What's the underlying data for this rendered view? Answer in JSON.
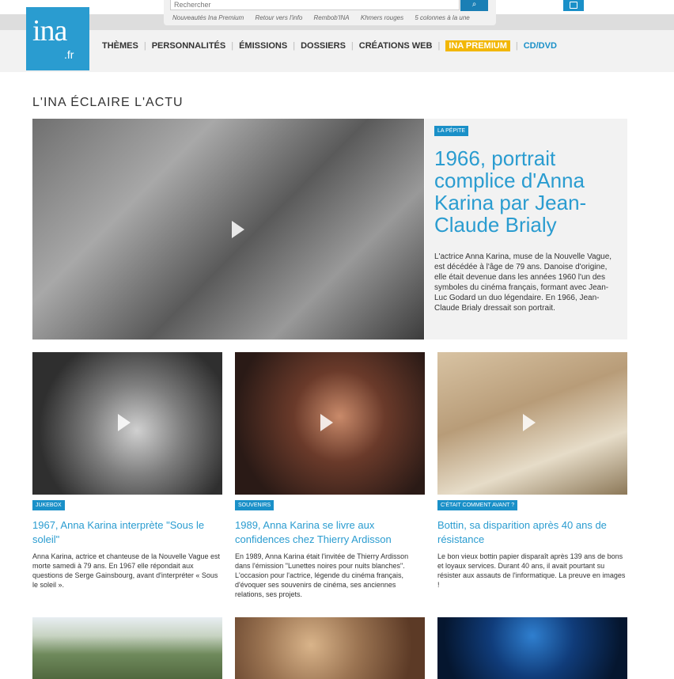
{
  "header": {
    "search_placeholder": "Rechercher",
    "search_button_icon": "search-icon",
    "quicklinks": [
      "Nouveautés Ina Premium",
      "Retour vers l'info",
      "Rembob'INA",
      "Khmers rouges",
      "5 colonnes à la une"
    ],
    "cart_icon": "cart-icon"
  },
  "logo": {
    "main": "ina",
    "suffix": ".fr"
  },
  "nav": {
    "items": [
      "THÈMES",
      "PERSONNALITÉS",
      "ÉMISSIONS",
      "DOSSIERS",
      "CRÉATIONS WEB"
    ],
    "premium": "INA PREMIUM",
    "cd": "CD/DVD"
  },
  "section_title": "L'INA ÉCLAIRE L'ACTU",
  "hero": {
    "tag": "LA PÉPITE",
    "title": "1966, portrait complice d'Anna Karina par Jean-Claude Brialy",
    "description": "L'actrice Anna Karina, muse de la Nouvelle Vague, est décédée à l'âge de 79 ans. Danoise d'origine, elle était devenue dans les années 1960 l'un des symboles du cinéma français, formant avec Jean-Luc Godard un duo légendaire. En 1966, Jean-Claude Brialy dressait son portrait."
  },
  "cards": [
    {
      "tag": "JUKEBOX",
      "title": "1967, Anna Karina interprète \"Sous le soleil\"",
      "description": "Anna Karina, actrice et chanteuse de la Nouvelle Vague est morte samedi à 79 ans. En 1967 elle répondait aux questions de Serge Gainsbourg, avant d'interpréter « Sous le soleil »."
    },
    {
      "tag": "SOUVENIRS",
      "title": "1989, Anna Karina se livre aux confidences chez Thierry Ardisson",
      "description": "En 1989, Anna Karina était l'invitée de Thierry Ardisson dans l'émission \"Lunettes noires pour nuits blanches\". L'occasion pour l'actrice, légende du cinéma français, d'évoquer ses souvenirs de cinéma, ses anciennes relations, ses projets."
    },
    {
      "tag": "C'ÉTAIT COMMENT AVANT ?",
      "title": "Bottin, sa disparition après 40 ans de résistance",
      "description": "Le bon vieux bottin papier disparaît après 139 ans de bons et loyaux services. Durant 40 ans, il avait pourtant su résister aux assauts de l'informatique. La preuve en images !"
    }
  ]
}
